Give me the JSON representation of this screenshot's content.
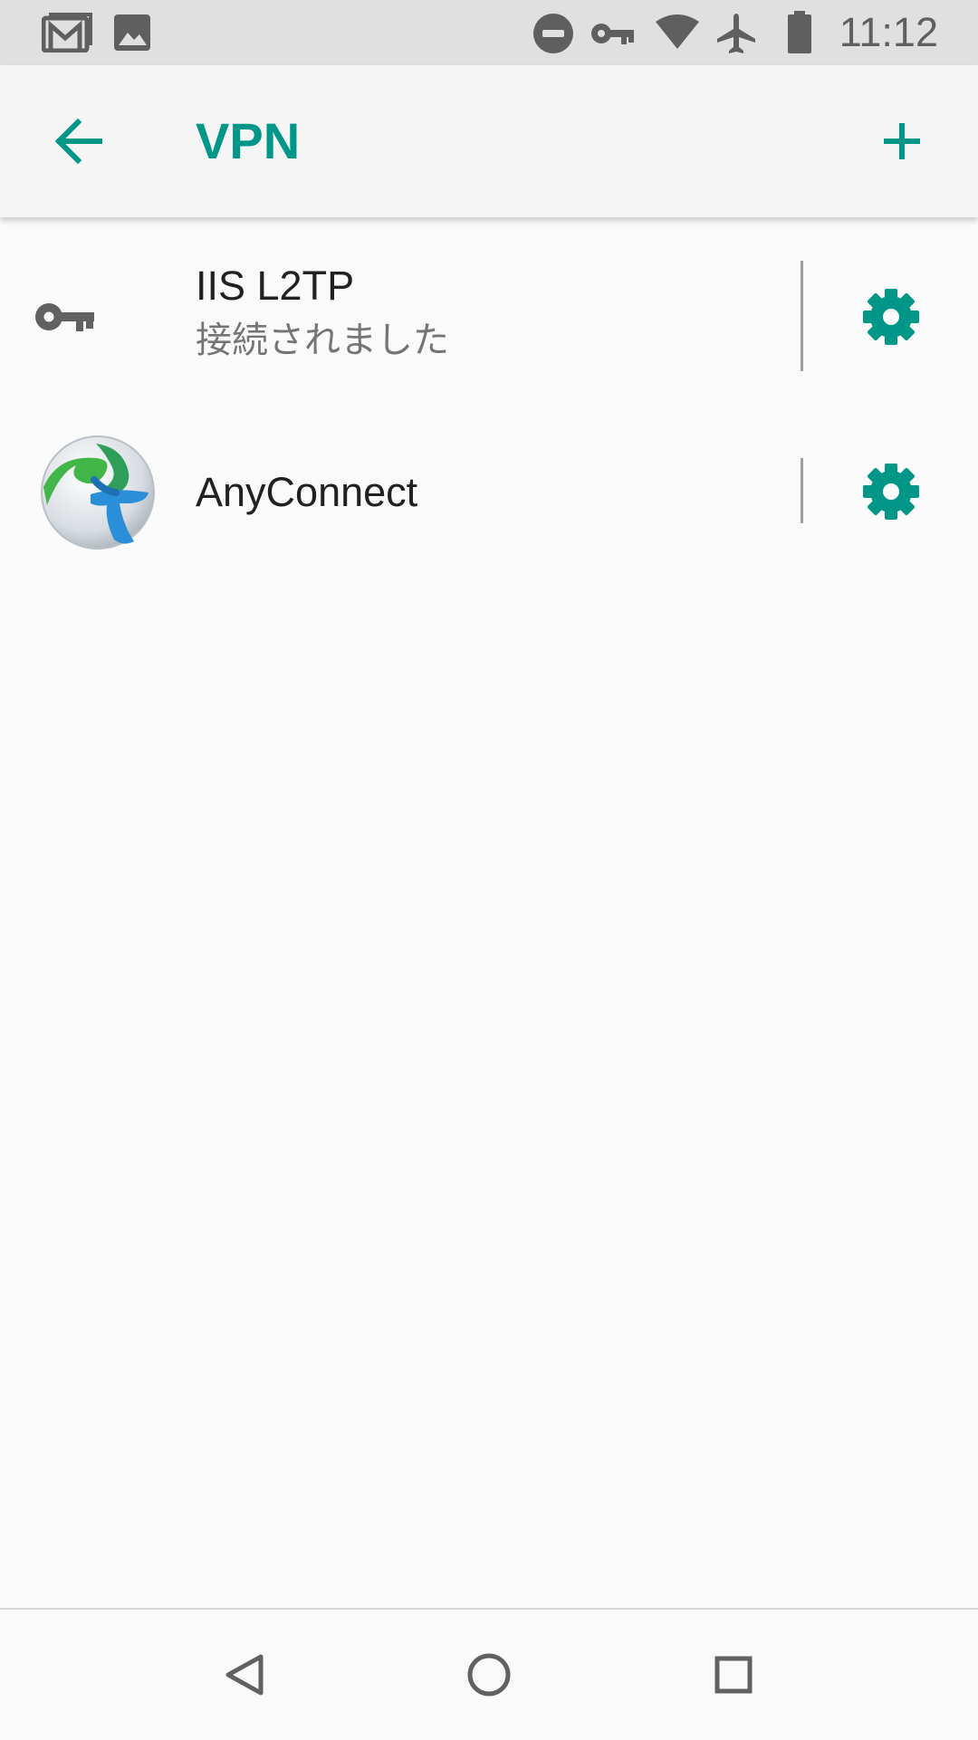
{
  "status_bar": {
    "time": "11:12",
    "left_icons": [
      "gmail-icon",
      "image-icon"
    ],
    "right_icons": [
      "do-not-disturb-icon",
      "vpn-key-icon",
      "wifi-icon",
      "airplane-icon",
      "battery-icon"
    ]
  },
  "app_bar": {
    "title": "VPN",
    "back_icon": "arrow-back-icon",
    "add_icon": "add-icon"
  },
  "vpn_list": [
    {
      "name": "IIS L2TP",
      "status": "接続されました",
      "icon": "vpn-key-icon",
      "settings_icon": "gear-icon"
    },
    {
      "name": "AnyConnect",
      "status": "",
      "icon": "anyconnect-app-icon",
      "settings_icon": "gear-icon"
    }
  ],
  "nav_bar": {
    "buttons": [
      "back-triangle-icon",
      "home-circle-icon",
      "recents-square-icon"
    ]
  },
  "colors": {
    "accent": "#009688",
    "status_bar_bg": "#e0e0e0",
    "app_bar_bg": "#f5f5f5",
    "background": "#fafafa",
    "primary_text": "#212121",
    "secondary_text": "#757575",
    "icon_gray": "#616161"
  }
}
